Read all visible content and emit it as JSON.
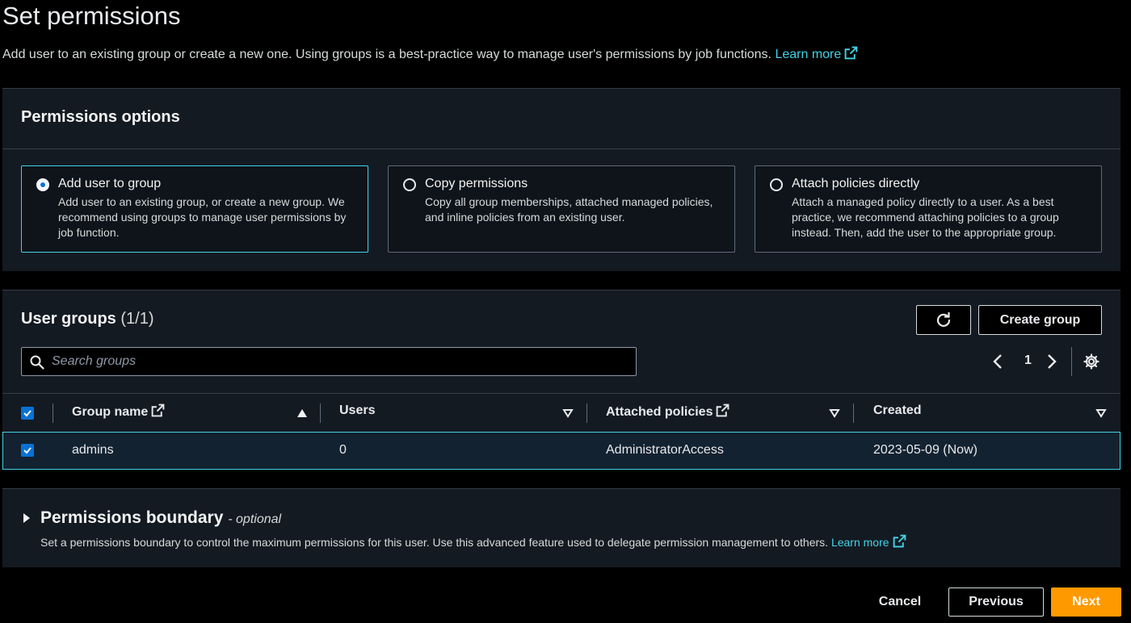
{
  "header": {
    "title": "Set permissions",
    "description": "Add user to an existing group or create a new one. Using groups is a best-practice way to manage user's permissions by job functions.",
    "learn_more": "Learn more"
  },
  "permissions_options": {
    "heading": "Permissions options",
    "options": [
      {
        "title": "Add user to group",
        "description": "Add user to an existing group, or create a new group. We recommend using groups to manage user permissions by job function.",
        "selected": true
      },
      {
        "title": "Copy permissions",
        "description": "Copy all group memberships, attached managed policies, and inline policies from an existing user.",
        "selected": false
      },
      {
        "title": "Attach policies directly",
        "description": "Attach a managed policy directly to a user. As a best practice, we recommend attaching policies to a group instead. Then, add the user to the appropriate group.",
        "selected": false
      }
    ]
  },
  "user_groups": {
    "heading": "User groups",
    "count": "(1/1)",
    "refresh_icon": "refresh-icon",
    "create_group_label": "Create group",
    "search_placeholder": "Search groups",
    "page_number": "1",
    "columns": [
      "Group name",
      "Users",
      "Attached policies",
      "Created"
    ],
    "rows": [
      {
        "group_name": "admins",
        "users": "0",
        "attached_policies": "AdministratorAccess",
        "created": "2023-05-09 (Now)",
        "checked": true
      }
    ]
  },
  "boundary": {
    "title": "Permissions boundary",
    "optional": "- optional",
    "description": "Set a permissions boundary to control the maximum permissions for this user. Use this advanced feature used to delegate permission management to others.",
    "learn_more": "Learn more"
  },
  "footer": {
    "cancel": "Cancel",
    "previous": "Previous",
    "next": "Next"
  },
  "colors": {
    "accent_link": "#42d3e6",
    "primary_button": "#ff9900",
    "selected_blue": "#0972d3"
  }
}
